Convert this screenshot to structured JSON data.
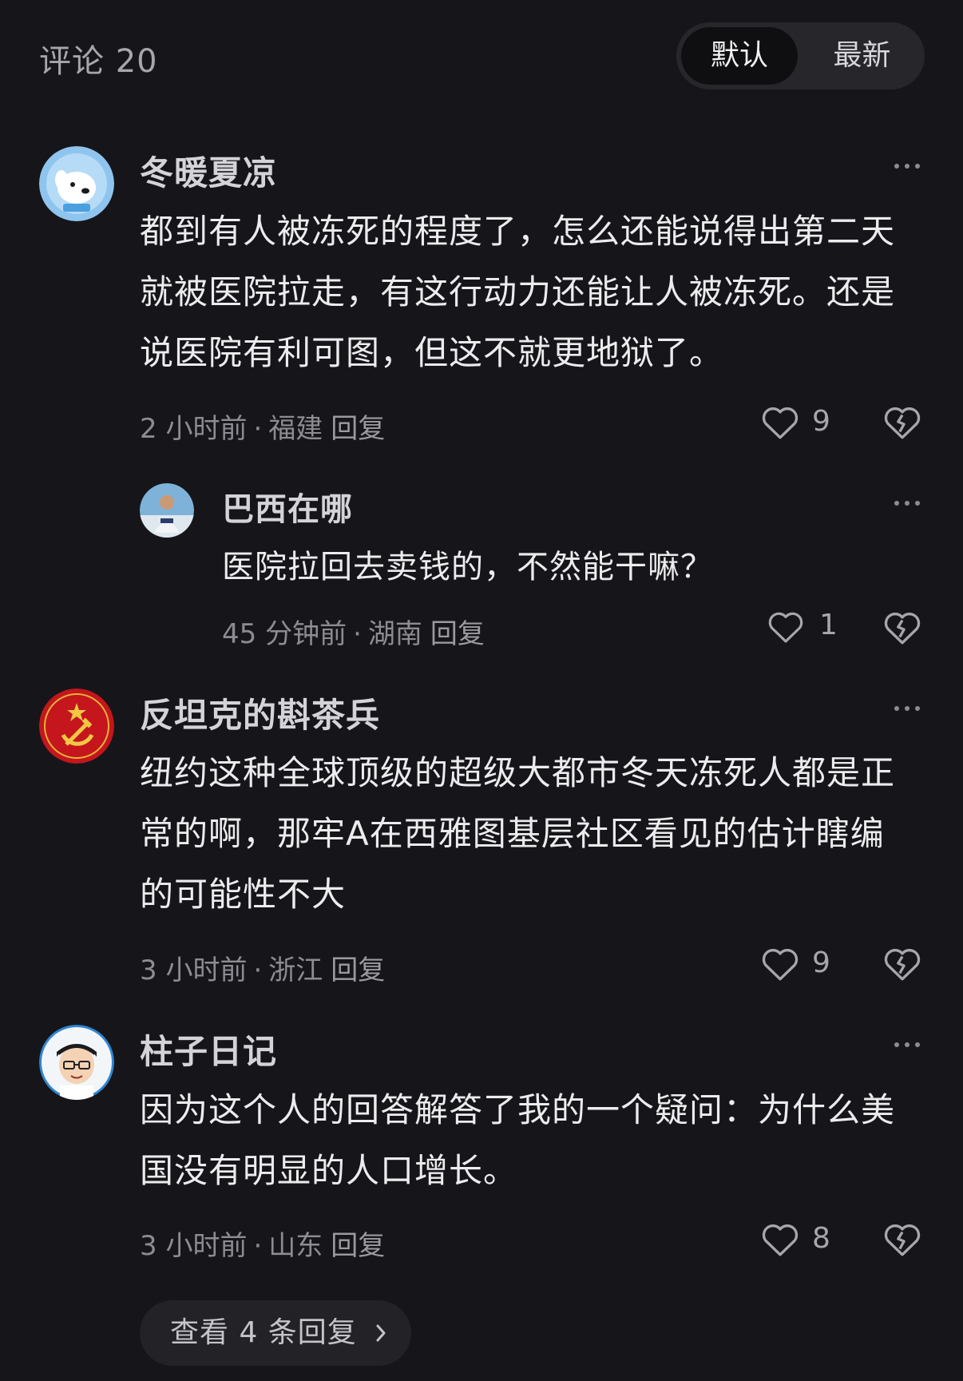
{
  "header": {
    "title": "评论 20",
    "sort_default": "默认",
    "sort_latest": "最新"
  },
  "comments": [
    {
      "username": "冬暖夏凉",
      "lines": [
        "都到有人被冻死的程度了，怎么还能说得出第二天",
        "就被医院拉走，有这行动力还能让人被冻死。还是",
        "说医院有利可图，但这不就更地狱了。"
      ],
      "time": "2 小时前",
      "location": "福建",
      "reply_label": "回复",
      "likes": "9",
      "replies": [
        {
          "username": "巴西在哪",
          "lines": [
            "医院拉回去卖钱的，不然能干嘛？"
          ],
          "time": "45 分钟前",
          "location": "湖南",
          "reply_label": "回复",
          "likes": "1"
        }
      ]
    },
    {
      "username": "反坦克的斟茶兵",
      "lines": [
        "纽约这种全球顶级的超级大都市冬天冻死人都是正",
        "常的啊，那牢A在西雅图基层社区看见的估计瞎编",
        "的可能性不大"
      ],
      "time": "3 小时前",
      "location": "浙江",
      "reply_label": "回复",
      "likes": "9"
    },
    {
      "username": "柱子日记",
      "lines": [
        "因为这个人的回答解答了我的一个疑问：为什么美",
        "国没有明显的人口增长。"
      ],
      "time": "3 小时前",
      "location": "山东",
      "reply_label": "回复",
      "likes": "8"
    }
  ],
  "view_more": {
    "label": "查看 4 条回复",
    "chevron_icon": "chevron-right-icon"
  },
  "icons": {
    "more": "more-horizontal-icon",
    "like": "heart-icon",
    "dislike": "broken-heart-icon"
  },
  "colors": {
    "background": "#16161a",
    "text_primary": "#ececee",
    "text_secondary": "#8c8c93"
  }
}
